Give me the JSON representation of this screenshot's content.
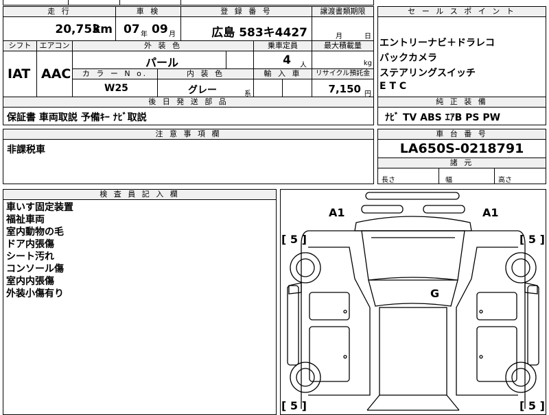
{
  "top_header": {
    "mileage": "走 行",
    "inspection": "車 検",
    "registration": "登 録 番 号",
    "transfer_docs": "譲渡書類期限",
    "sales_points": "セ ー ル ス ポ イ ン ト"
  },
  "mileage": {
    "value": "20,753",
    "unit": "km"
  },
  "inspection": {
    "year": "07",
    "year_unit": "年",
    "month": "09",
    "month_unit": "月"
  },
  "registration": {
    "plate": "広島 583キ4427"
  },
  "transfer_docs": {
    "month_label": "月",
    "day_label": "日"
  },
  "row2_header": {
    "shift": "シフト",
    "aircon": "エアコン",
    "exterior_color": "外 装 色",
    "capacity": "乗車定員",
    "max_load": "最大積載量"
  },
  "shift": "IAT",
  "aircon": "AAC",
  "exterior_color": "パール",
  "capacity": {
    "value": "4",
    "unit": "人"
  },
  "max_load": {
    "unit": "kg"
  },
  "row3_header": {
    "color_no": "カ ラ ー N o.",
    "interior_color": "内 装 色",
    "import": "輸 入 車",
    "recycle": "リサイクル預託金"
  },
  "color_no": "W25",
  "interior_color": {
    "value": "グレー",
    "suffix": "系"
  },
  "recycle": {
    "value": "7,150",
    "unit": "円"
  },
  "sales_points": [
    "エントリーナビ＋ドラレコ",
    "バックカメラ",
    "ステアリングスイッチ",
    "E T C"
  ],
  "later_parts": {
    "header": "後 日 発 送 部 品",
    "value": "保証書 車両取説 予備ｷｰ ﾅﾋﾞ取説"
  },
  "genuine_equipment": {
    "header": "純 正 装 備",
    "value": "ﾅﾋﾞ TV ABS ｴｱB PS PW"
  },
  "notes": {
    "header": "注 意 事 項 欄",
    "value": "非課税車"
  },
  "chassis": {
    "header": "車 台 番 号",
    "value": "LA650S-0218791"
  },
  "dimensions": {
    "header": "諸 元",
    "length": "長さ",
    "width": "幅",
    "height": "高さ"
  },
  "inspector": {
    "header": "検 査 員 記 入 欄",
    "lines": [
      "車いす固定装置",
      "福祉車両",
      "室内動物の毛",
      "ドア内張傷",
      "シート汚れ",
      "コンソール傷",
      "室内内張傷",
      "外装小傷有り"
    ]
  },
  "diagram_marks": {
    "front_left": "A1",
    "front_right": "A1",
    "tire_fl": "[ 5 ]",
    "tire_fr": "[ 5 ]",
    "tire_rl": "[ 5 ]",
    "tire_rr": "[ 5 ]",
    "glass": "G"
  }
}
